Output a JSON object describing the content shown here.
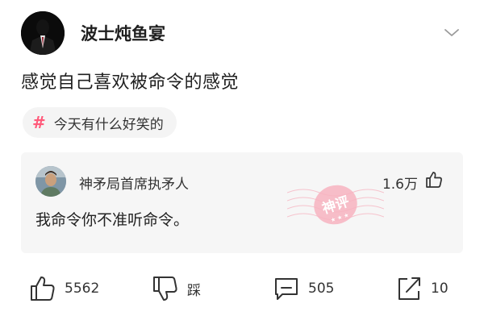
{
  "header": {
    "author": "波士炖鱼宴"
  },
  "post": {
    "title": "感觉自己喜欢被命令的感觉"
  },
  "topic": {
    "hash": "#",
    "label": "今天有什么好笑的"
  },
  "comment": {
    "user": "神矛局首席执矛人",
    "likes": "1.6万",
    "text": "我命令你不准听命令。",
    "stamp": "神评"
  },
  "actions": {
    "like_count": "5562",
    "dislike_label": "踩",
    "comment_count": "505",
    "share_count": "10"
  },
  "colors": {
    "accent_pink": "#ff5a7a",
    "stamp_pink": "#f3a0b0"
  }
}
